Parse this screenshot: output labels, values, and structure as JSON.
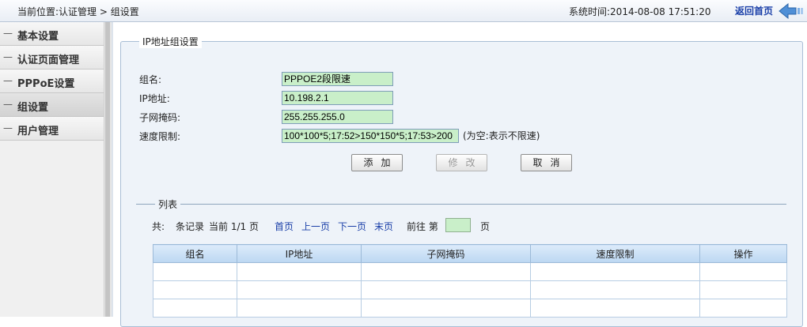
{
  "header": {
    "breadcrumb": "当前位置:认证管理 > 组设置",
    "system_time": "系统时间:2014-08-08 17:51:20",
    "home_link": "返回首页"
  },
  "sidebar": {
    "items": [
      {
        "label": "基本设置",
        "active": false
      },
      {
        "label": "认证页面管理",
        "active": false
      },
      {
        "label": "PPPoE设置",
        "active": false
      },
      {
        "label": "组设置",
        "active": true
      },
      {
        "label": "用户管理",
        "active": false
      }
    ],
    "dash": "—"
  },
  "form": {
    "legend": "IP地址组设置",
    "group_name_label": "组名:",
    "group_name_value": "PPPOE2段限速",
    "ip_label": "IP地址:",
    "ip_value": "10.198.2.1",
    "mask_label": "子网掩码:",
    "mask_value": "255.255.255.0",
    "speed_label": "速度限制:",
    "speed_value": "100*100*5;17:52>150*150*5;17:53>200",
    "speed_hint": "(为空:表示不限速)",
    "add_button": "添加",
    "modify_button": "修改",
    "cancel_button": "取消"
  },
  "list": {
    "title": "列表",
    "pager": {
      "total_prefix": "共:",
      "records_label": "条记录",
      "current_page": "当前 1/1 页",
      "first": "首页",
      "prev": "上一页",
      "next": "下一页",
      "last": "末页",
      "goto_label": "前往 第",
      "page_value": "",
      "page_suffix": "页"
    },
    "columns": [
      "组名",
      "IP地址",
      "子网掩码",
      "速度限制",
      "操作"
    ]
  },
  "colors": {
    "input_bg": "#c9efc9",
    "link": "#1a3fa8",
    "header_grad": "#bcd7f2"
  }
}
